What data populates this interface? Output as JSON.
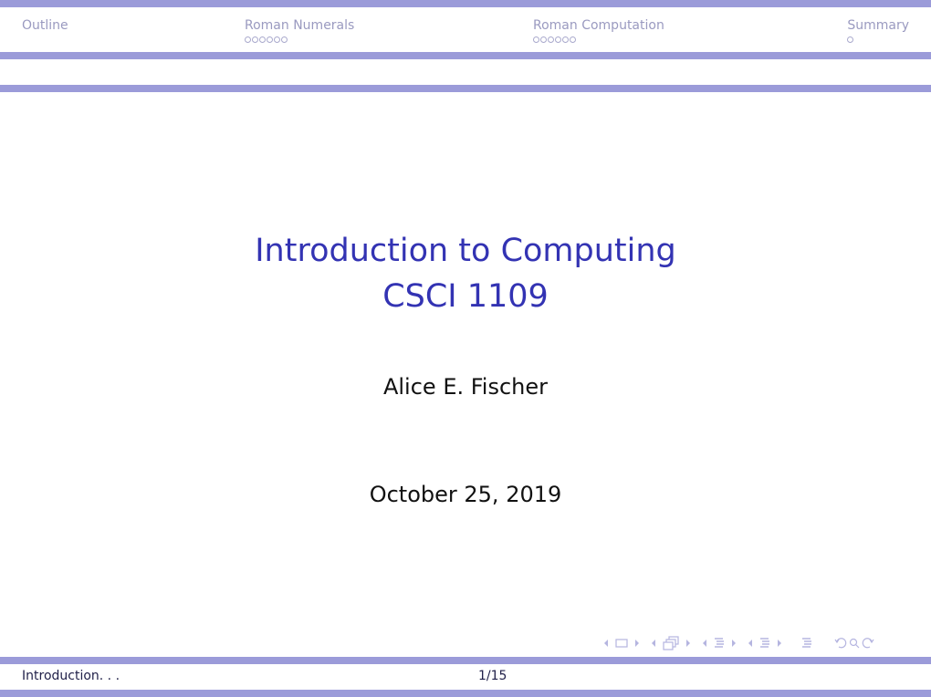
{
  "header": {
    "sections": [
      {
        "label": "Outline",
        "dots": 0
      },
      {
        "label": "Roman Numerals",
        "dots": 6
      },
      {
        "label": "Roman Computation",
        "dots": 6
      },
      {
        "label": "Summary",
        "dots": 1
      }
    ]
  },
  "slide": {
    "title_line1": "Introduction to Computing",
    "title_line2": "CSCI 1109",
    "author": "Alice E. Fischer",
    "date": "October 25, 2019"
  },
  "navigation": {
    "icons": [
      "prev-arrow",
      "frame-icon",
      "next-arrow",
      "prev-arrow",
      "subsection-icon",
      "next-arrow",
      "prev-arrow",
      "section-icon",
      "next-arrow",
      "prev-arrow",
      "section-list-icon",
      "next-arrow",
      "document-icon",
      "undo-icon",
      "search-icon",
      "redo-icon"
    ]
  },
  "footer": {
    "short_title": "Introduction. . .",
    "page": "1/15"
  },
  "colors": {
    "bar": "#9b9bd9",
    "title": "#3333b3",
    "nav_text": "#9a9ac0",
    "nav_symbols": "#b5b5e0"
  }
}
